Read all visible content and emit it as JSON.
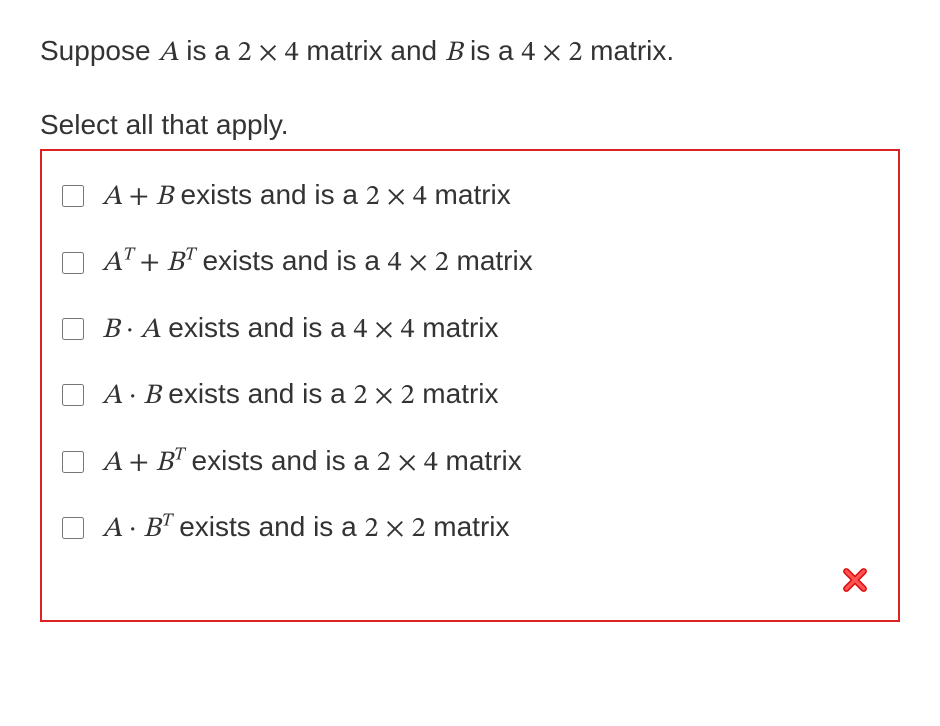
{
  "prompt": {
    "pre1": "Suppose ",
    "A": "A",
    "pre2": " is a ",
    "dimA": "2 × 4",
    "pre3": " matrix and ",
    "B": "B",
    "pre4": " is a ",
    "dimB": "4 × 2",
    "pre5": " matrix."
  },
  "instruction": "Select all that apply.",
  "options": [
    {
      "exprA": "A",
      "op": " + ",
      "exprB": "B",
      "supA": "",
      "supB": "",
      "tail1": " exists and is a ",
      "dim": "2 × 4",
      "tail2": " matrix"
    },
    {
      "exprA": "A",
      "op": " + ",
      "exprB": "B",
      "supA": "T",
      "supB": "T",
      "tail1": " exists and is a ",
      "dim": "4 × 2",
      "tail2": " matrix"
    },
    {
      "exprA": "B",
      "op": " · ",
      "exprB": "A",
      "supA": "",
      "supB": "",
      "tail1": " exists and is a ",
      "dim": "4 × 4",
      "tail2": " matrix"
    },
    {
      "exprA": "A",
      "op": " · ",
      "exprB": "B",
      "supA": "",
      "supB": "",
      "tail1": " exists and is a ",
      "dim": "2 × 2",
      "tail2": " matrix"
    },
    {
      "exprA": "A",
      "op": " + ",
      "exprB": "B",
      "supA": "",
      "supB": "T",
      "tail1": " exists and is a ",
      "dim": "2 × 4",
      "tail2": " matrix"
    },
    {
      "exprA": "A",
      "op": " · ",
      "exprB": "B",
      "supA": "",
      "supB": "T",
      "tail1": " exists and is a ",
      "dim": "2 × 2",
      "tail2": " matrix"
    }
  ],
  "feedback": {
    "icon": "wrong-icon",
    "correct": false
  }
}
